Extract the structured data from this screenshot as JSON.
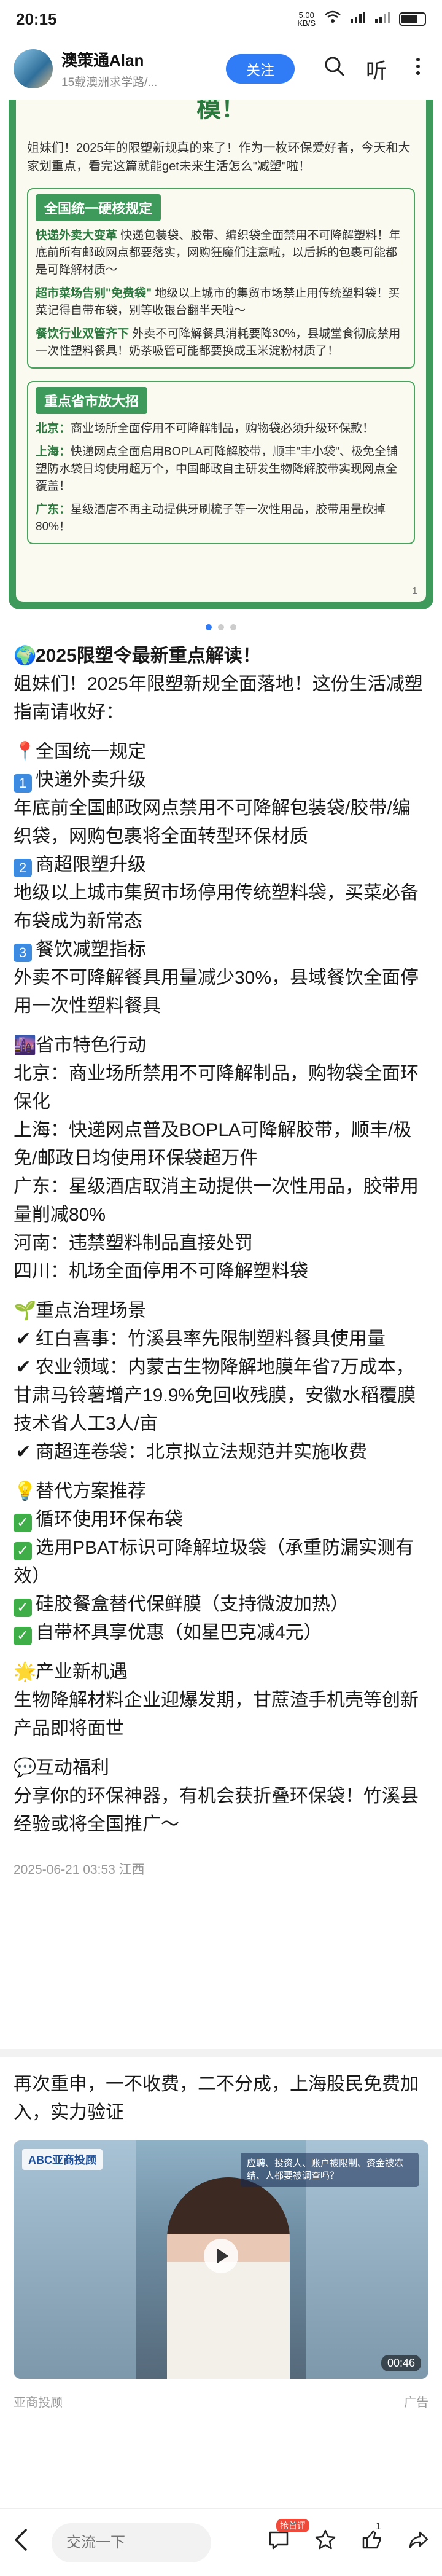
{
  "status_bar": {
    "time": "20:15",
    "net_speed_value": "5.00",
    "net_speed_unit": "KB/S",
    "battery_level": 0.6
  },
  "header": {
    "author_name": "澳策通Alan",
    "author_sub": "15载澳洲求学路/...",
    "follow_label": "关注",
    "listen_label": "听"
  },
  "image_card": {
    "title_tail": "模！",
    "intro": "姐妹们！2025年的限塑新规真的来了！作为一枚环保爱好者，今天和大家划重点，看完这篇就能get未来生活怎么\"减塑\"啦！",
    "section1_title": "全国统一硬核规定",
    "section1_items": [
      {
        "label": "快递外卖大变革",
        "text": "快递包装袋、胶带、编织袋全面禁用不可降解塑料！年底前所有邮政网点都要落实，网购狂魔们注意啦，以后拆的包裹可能都是可降解材质～"
      },
      {
        "label": "超市菜场告别\"免费袋\"",
        "text": "地级以上城市的集贸市场禁止用传统塑料袋！买菜记得自带布袋，别等收银台翻半天啦～"
      },
      {
        "label": "餐饮行业双管齐下",
        "text": "外卖不可降解餐具消耗要降30%，县城堂食彻底禁用一次性塑料餐具！奶茶吸管可能都要换成玉米淀粉材质了！"
      }
    ],
    "section2_title": "重点省市放大招",
    "section2_items": [
      {
        "label": "北京：",
        "text": "商业场所全面停用不可降解制品，购物袋必须升级环保款！"
      },
      {
        "label": "上海：",
        "text": "快递网点全面启用BOPLA可降解胶带，顺丰\"丰小袋\"、极免全铺塑防水袋日均使用超万个，中国邮政自主研发生物降解胶带实现网点全覆盖！"
      },
      {
        "label": "广东：",
        "text": "星级酒店不再主动提供牙刷梳子等一次性用品，胶带用量砍掉80%！"
      }
    ],
    "page_number": "1",
    "carousel_count": 3,
    "carousel_active": 0
  },
  "article": {
    "headline": "2025限塑令最新重点解读！",
    "intro": "姐妹们！2025年限塑新规全面落地！这份生活减塑指南请收好：",
    "s1_title": "全国统一规定",
    "s1_items": [
      {
        "num": "1",
        "title": "快递外卖升级",
        "text": "年底前全国邮政网点禁用不可降解包装袋/胶带/编织袋，网购包裹将全面转型环保材质"
      },
      {
        "num": "2",
        "title": "商超限塑升级",
        "text": "地级以上城市集贸市场停用传统塑料袋，买菜必备布袋成为新常态"
      },
      {
        "num": "3",
        "title": "餐饮减塑指标",
        "text": "外卖不可降解餐具用量减少30%，县域餐饮全面停用一次性塑料餐具"
      }
    ],
    "s2_title": "省市特色行动",
    "s2_items": [
      "北京：商业场所禁用不可降解制品，购物袋全面环保化",
      "上海：快递网点普及BOPLA可降解胶带，顺丰/极免/邮政日均使用环保袋超万件",
      "广东：星级酒店取消主动提供一次性用品，胶带用量削减80%",
      "河南：违禁塑料制品直接处罚",
      "四川：机场全面停用不可降解塑料袋"
    ],
    "s3_title": "重点治理场景",
    "s3_items": [
      "红白喜事：竹溪县率先限制塑料餐具使用量",
      "农业领域：内蒙古生物降解地膜年省7万成本，甘肃马铃薯增产19.9%免回收残膜，安徽水稻覆膜技术省人工3人/亩",
      "商超连卷袋：北京拟立法规范并实施收费"
    ],
    "s4_title": "替代方案推荐",
    "s4_items": [
      "循环使用环保布袋",
      "选用PBAT标识可降解垃圾袋（承重防漏实测有效）",
      "硅胶餐盒替代保鲜膜（支持微波加热）",
      "自带杯具享优惠（如星巴克减4元）"
    ],
    "s5_title": "产业新机遇",
    "s5_text": "生物降解材料企业迎爆发期，甘蔗渣手机壳等创新产品即将面世",
    "s6_title": "互动福利",
    "s6_text": "分享你的环保神器，有机会获折叠环保袋！竹溪县经验或将全国推广～",
    "meta": "2025-06-21 03:53  江西"
  },
  "related": {
    "title": "再次重申，一不收费，二不分成，上海股民免费加入，实力验证",
    "video_logo": "ABC亚商投顾",
    "video_caption": "应聘、投资人、账户被限制、资金被冻结、人都要被调查吗？",
    "duration": "00:46",
    "source": "亚商投顾",
    "ad_label": "广告"
  },
  "bottom_bar": {
    "comment_placeholder": "交流一下",
    "grab_badge": "抢首评",
    "like_count": "1"
  }
}
